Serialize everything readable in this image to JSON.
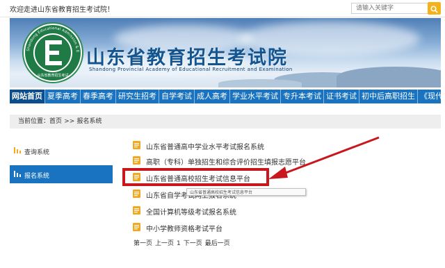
{
  "topbar": {
    "welcome": "欢迎走进山东省教育招生考试院！",
    "search_placeholder": "请输入关键字"
  },
  "banner": {
    "title_cn": "山东省教育招生考试院",
    "title_en": "Shandong Provincial Academy of Educational Recruitment and Examination",
    "logo_ring_text": "Shandong Educational Admission & Examination",
    "logo_bottom_text": "山东省教育招生考试"
  },
  "nav": {
    "items": [
      "网站首页",
      "夏季高考",
      "春季高考",
      "研究生招考",
      "自学考试",
      "成人高考",
      "学业水平考试",
      "专升本考试",
      "证书考试",
      "初中后高职招生",
      "《现代教育》"
    ]
  },
  "breadcrumb": {
    "label": "当前位置：",
    "home": "首页",
    "separator": ">>",
    "current": "报名系统"
  },
  "sidebar": {
    "items": [
      {
        "label": "查询系统",
        "active": false
      },
      {
        "label": "报名系统",
        "active": true
      }
    ]
  },
  "list": {
    "items": [
      "山东省普通高中学业水平考试报名系统",
      "高职（专科）单独招生和综合评价招生填报志愿平台",
      "山东省普通高校招生考试信息平台",
      "山东省自学考试网上报名系统",
      "全国计算机等级考试报名系统",
      "中小学教师资格考试平台"
    ],
    "tooltip": "山东省普通高校招生考试信息平台"
  },
  "pager": {
    "first": "第一页",
    "prev": "上一页",
    "current": "1",
    "next": "下一页",
    "last": "最后一页"
  },
  "colors": {
    "nav_blue": "#1a73c0",
    "nav_active": "#0b4e8d",
    "search_button": "#f4b21a",
    "highlight_red": "#c8171d",
    "doc_icon": "#f2a81d"
  }
}
